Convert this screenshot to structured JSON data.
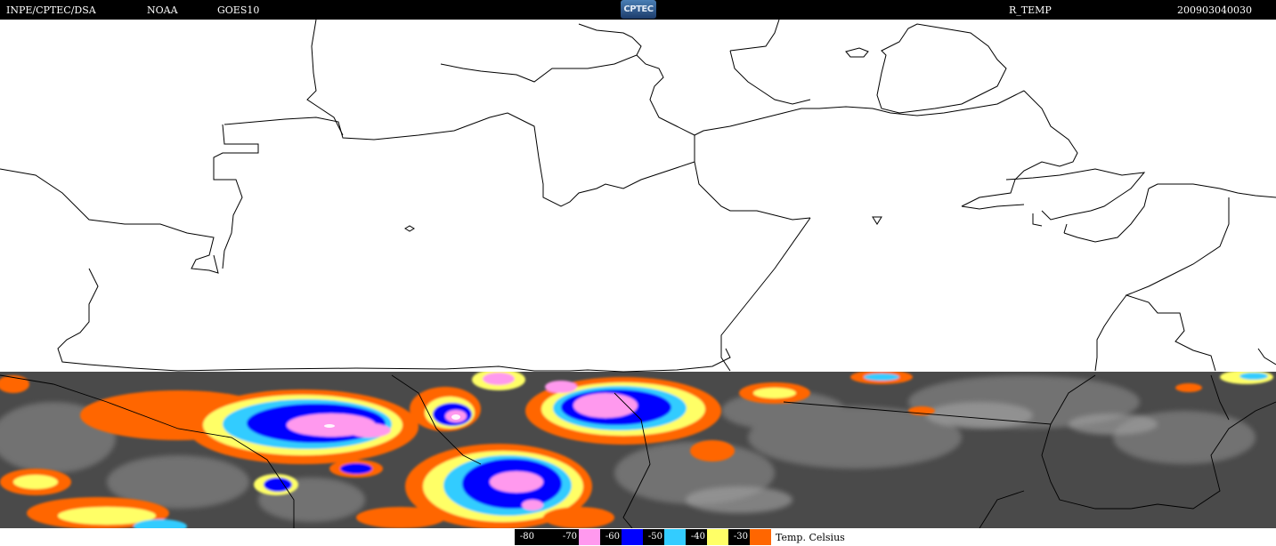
{
  "header": {
    "agency": "INPE/CPTEC/DSA",
    "provider": "NOAA",
    "satellite": "GOES10",
    "logo_text": "CPTEC",
    "product": "R_TEMP",
    "timestamp": "200903040030"
  },
  "legend": {
    "items": [
      {
        "label": "-80",
        "color": "#000000"
      },
      {
        "label": "-70",
        "color": "#ff99ee"
      },
      {
        "label": "-60",
        "color": "#0000ff"
      },
      {
        "label": "-50",
        "color": "#33ccff"
      },
      {
        "label": "-40",
        "color": "#ffff66"
      },
      {
        "label": "-30",
        "color": "#ff6600"
      }
    ],
    "title": "Temp. Celsius"
  },
  "colors": {
    "background": "#ffffff",
    "header_bg": "#000000",
    "satellite_gray_dark": "#3a3a3a",
    "satellite_gray_light": "#8a8a8a",
    "border_lines": "#000000"
  }
}
